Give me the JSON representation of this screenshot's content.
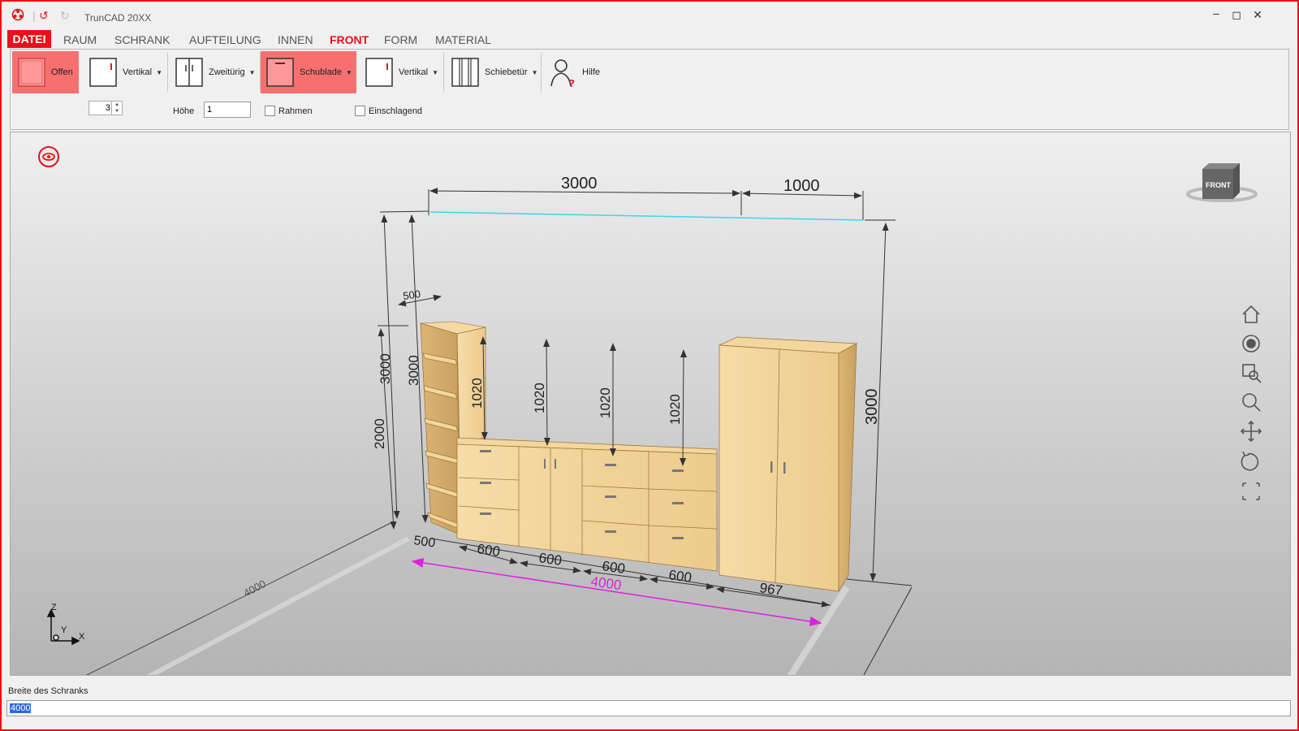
{
  "app": {
    "title": "TrunCAD 20XX"
  },
  "menu": {
    "file": "DATEI",
    "items": [
      "RAUM",
      "SCHRANK",
      "AUFTEILUNG",
      "INNEN",
      "FRONT",
      "FORM",
      "MATERIAL"
    ]
  },
  "ribbon": {
    "buttons": [
      {
        "label": "Offen"
      },
      {
        "label": "Vertikal"
      },
      {
        "label": "Zweitürig"
      },
      {
        "label": "Schublade"
      },
      {
        "label": "Vertikal"
      },
      {
        "label": "Schiebetür"
      },
      {
        "label": "Hilfe"
      }
    ],
    "spinner_value": "3",
    "hoehe_label": "Höhe",
    "hoehe_value": "1",
    "rahmen_label": "Rahmen",
    "einschlagend_label": "Einschlagend"
  },
  "viewport": {
    "cube_label": "FRONT",
    "axes": {
      "z": "Z",
      "y": "Y",
      "x": "X"
    },
    "dimensions": {
      "top_left": "3000",
      "top_right": "1000",
      "depth_top": "500",
      "height_left_outer": "3000",
      "height_left_inner": "3000",
      "height_low": "2000",
      "right_height": "3000",
      "floor_depth": "4000",
      "inner_1": "1020",
      "inner_2": "1020",
      "inner_3": "1020",
      "inner_4": "1020",
      "bottom_widths": [
        "500",
        "600",
        "600",
        "600",
        "600",
        "967"
      ],
      "total_width": "4000"
    }
  },
  "statusbar": {
    "label": "Breite des Schranks",
    "value": "4000"
  },
  "colors": {
    "accent": "#e8101a",
    "selected": "#f76f6f",
    "dimension_highlight": "#e020e0",
    "cyan_line": "#3cd8e8",
    "wood": "#f1d49a"
  }
}
